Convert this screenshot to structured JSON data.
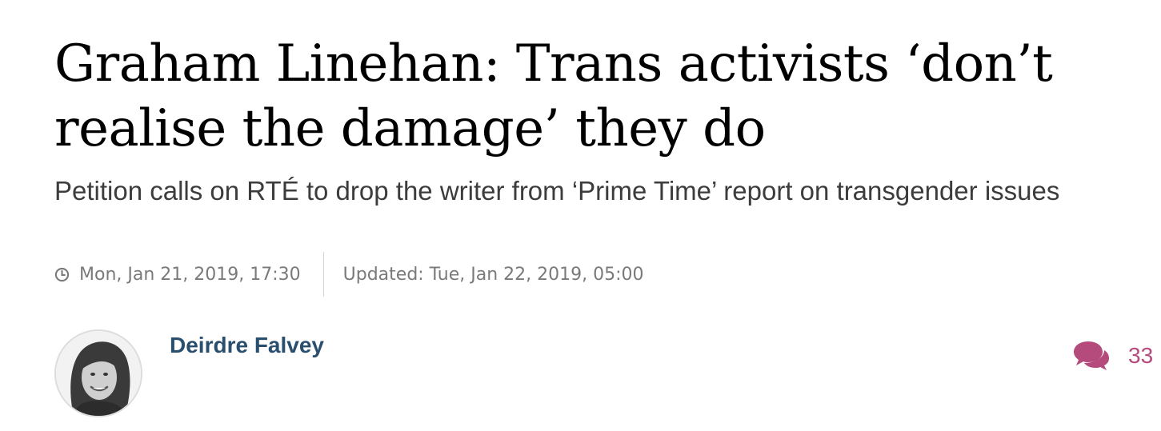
{
  "article": {
    "headline": "Graham Linehan: Trans activists ‘don’t realise the damage’ they do",
    "standfirst": "Petition calls on RTÉ to drop the writer from ‘Prime Time’ report on transgender issues",
    "published": "Mon, Jan 21, 2019, 17:30",
    "updated": "Updated: Tue, Jan 22, 2019, 05:00",
    "author": {
      "name": "Deirdre Falvey",
      "avatar_icon": "author-photo"
    },
    "comments": {
      "icon": "comments-icon",
      "count": "33"
    }
  },
  "colors": {
    "headline": "#000000",
    "standfirst": "#3c3c3c",
    "meta": "#7a7a7a",
    "author": "#2a4e6e",
    "comments_accent": "#b54a7c"
  }
}
